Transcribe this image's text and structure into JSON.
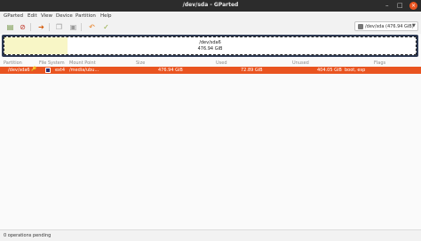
{
  "window": {
    "title": "/dev/sda - GParted",
    "minimize_glyph": "–",
    "maximize_glyph": "□",
    "close_glyph": "×"
  },
  "menu": [
    "GParted",
    "Edit",
    "View",
    "Device",
    "Partition",
    "Help"
  ],
  "toolbar": {
    "icons": [
      "new-partition-icon",
      "delete-icon",
      "resize-move-icon",
      "copy-icon",
      "paste-icon",
      "undo-icon",
      "apply-icon"
    ],
    "device": "/dev/sda (476.94 GiB)"
  },
  "disk_map": {
    "partition": "/dev/sda6",
    "size": "476.94 GiB",
    "used_fraction": 0.153
  },
  "table": {
    "headers": [
      "Partition",
      "File System",
      "Mount Point",
      "Size",
      "Used",
      "Unused",
      "Flags"
    ],
    "rows": [
      {
        "partition": "/dev/sda6",
        "filesystem": "ext4",
        "mount_point": "/media/ubu...",
        "size": "476.94 GiB",
        "used": "72.89 GiB",
        "unused": "404.05 GiB",
        "flags": "boot, esp"
      }
    ]
  },
  "status": "0 operations pending",
  "colors": {
    "accent": "#e95420",
    "titlebar": "#2c2c2c",
    "used_space": "#f8f6c6",
    "ext4": "#2b2b6e"
  }
}
